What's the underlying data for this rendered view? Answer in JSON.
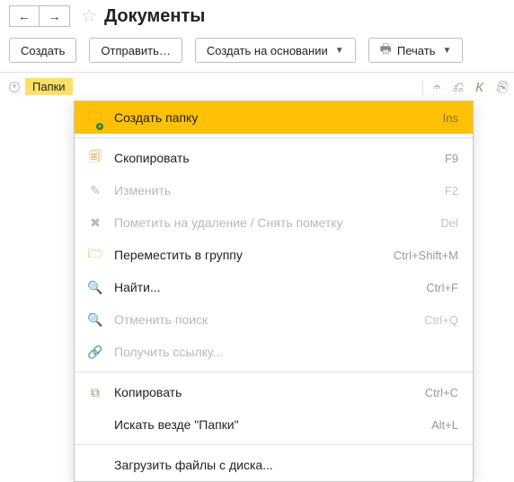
{
  "header": {
    "title": "Документы"
  },
  "toolbar": {
    "create": "Создать",
    "send": "Отправить…",
    "create_based_on": "Создать на основании",
    "print": "Печать"
  },
  "tree": {
    "root_label": "Папки"
  },
  "side_icons": {
    "attachment": "attachment-icon",
    "bookmark": "bookmark-icon",
    "italic": "italic-k-icon",
    "export": "export-icon"
  },
  "context_menu": {
    "items": [
      {
        "label": "Создать папку",
        "shortcut": "Ins",
        "icon": "folder-plus-icon",
        "enabled": true,
        "highlight": true
      },
      {
        "label": "Скопировать",
        "shortcut": "F9",
        "icon": "copy-doc-icon",
        "enabled": true
      },
      {
        "label": "Изменить",
        "shortcut": "F2",
        "icon": "pencil-icon",
        "enabled": false
      },
      {
        "label": "Пометить на удаление / Снять пометку",
        "shortcut": "Del",
        "icon": "trash-mark-icon",
        "enabled": false
      },
      {
        "label": "Переместить в группу",
        "shortcut": "Ctrl+Shift+M",
        "icon": "move-group-icon",
        "enabled": true
      },
      {
        "label": "Найти...",
        "shortcut": "Ctrl+F",
        "icon": "search-icon",
        "enabled": true
      },
      {
        "label": "Отменить поиск",
        "shortcut": "Ctrl+Q",
        "icon": "search-cancel-icon",
        "enabled": false
      },
      {
        "label": "Получить ссылку...",
        "shortcut": "",
        "icon": "link-icon",
        "enabled": false
      },
      {
        "label": "Копировать",
        "shortcut": "Ctrl+C",
        "icon": "copy-icon",
        "enabled": true
      },
      {
        "label": "Искать везде \"Папки\"",
        "shortcut": "Alt+L",
        "icon": "",
        "enabled": true
      },
      {
        "label": "Загрузить файлы с диска...",
        "shortcut": "",
        "icon": "",
        "enabled": true
      }
    ],
    "separators_after": [
      0,
      7,
      9
    ]
  }
}
